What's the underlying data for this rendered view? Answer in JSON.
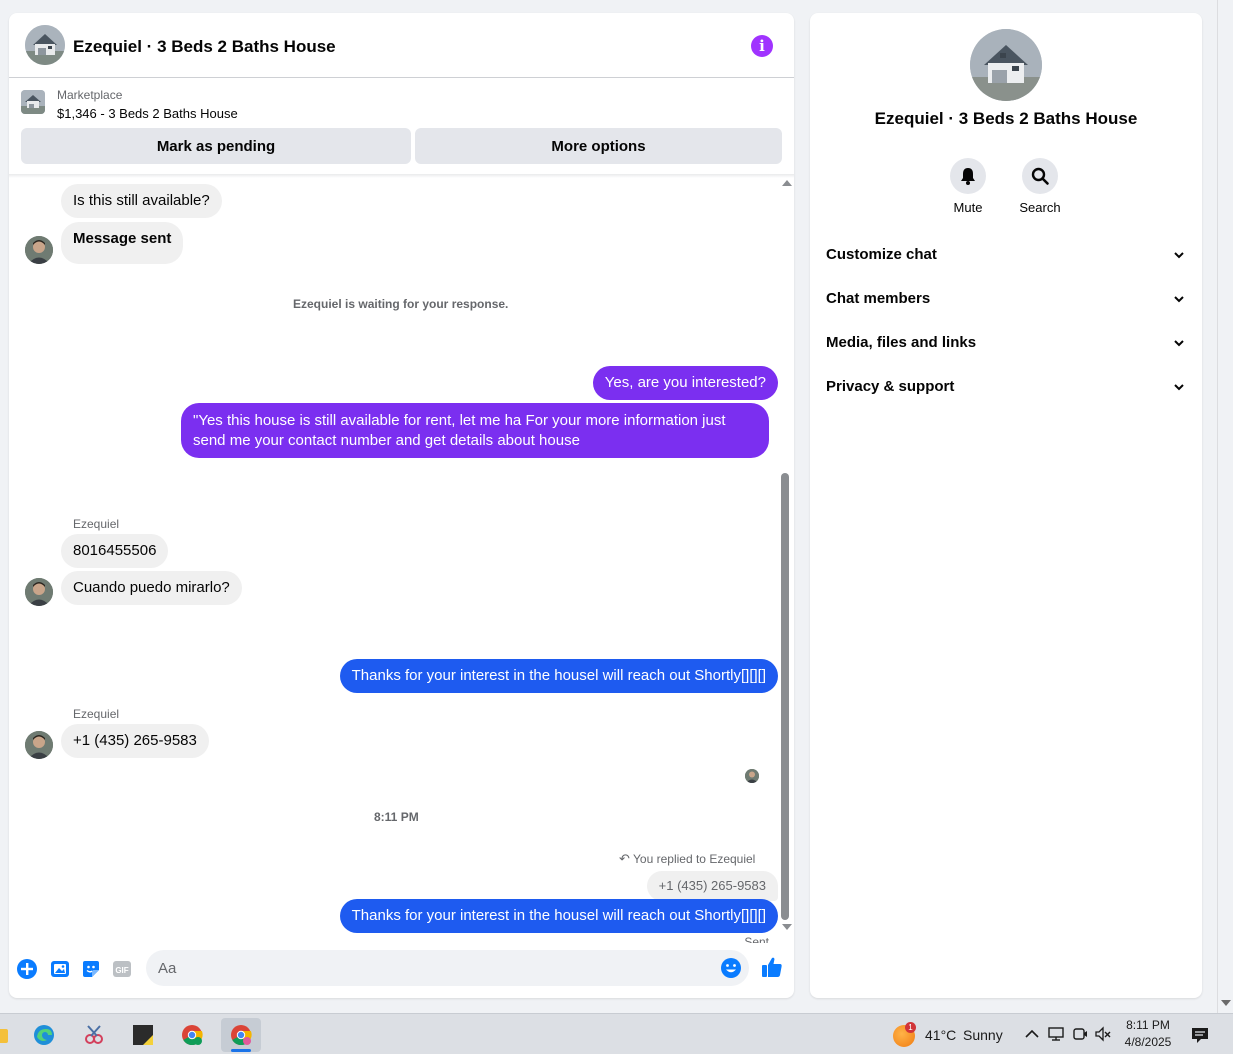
{
  "header": {
    "title": "Ezequiel · 3 Beds 2 Baths House",
    "info_icon": "info-icon",
    "accent_color": "#a033ff"
  },
  "listing": {
    "label": "Marketplace",
    "item": "$1,346 - 3 Beds 2 Baths House",
    "mark_pending": "Mark as pending",
    "more_options": "More options"
  },
  "messages": {
    "m1": "Is this still available?",
    "m2": "Message sent",
    "waiting": "Ezequiel is waiting for your response.",
    "m3": "Yes, are you interested?",
    "m4_line1": "\"Yes this house is still available for rent, let me ha For  your  more  information  just",
    "m4_line2": "send  me   your  contact  number  and get details about house",
    "sender1": "Ezequiel",
    "m5": "8016455506",
    "m6": "Cuando puedo mirarlo?",
    "m7": "Thanks for your interest in the housel will reach out Shortly[][][]",
    "sender2": "Ezequiel",
    "m8": "+1 (435) 265-9583",
    "timestamp": "8:11 PM",
    "reply_note": "You replied to Ezequiel",
    "quoted": "+1 (435) 265-9583",
    "m9": "Thanks for your interest in the housel will reach out Shortly[][][]",
    "status": "Sent"
  },
  "composer": {
    "placeholder": "Aa",
    "value": ""
  },
  "info_panel": {
    "title": "Ezequiel · 3 Beds 2 Baths House",
    "mute_label": "Mute",
    "search_label": "Search",
    "sections": [
      {
        "label": "Customize chat"
      },
      {
        "label": "Chat members"
      },
      {
        "label": "Media, files and links"
      },
      {
        "label": "Privacy & support"
      }
    ]
  },
  "taskbar": {
    "temperature": "41°C",
    "condition": "Sunny",
    "weather_badge": "1",
    "time": "8:11 PM",
    "date": "4/8/2025"
  },
  "colors": {
    "outgoing_purple": "#7b2ff0",
    "outgoing_blue": "#1e5bf0",
    "incoming_bg": "#f0f0f0",
    "messenger_blue": "#0a7cff"
  }
}
